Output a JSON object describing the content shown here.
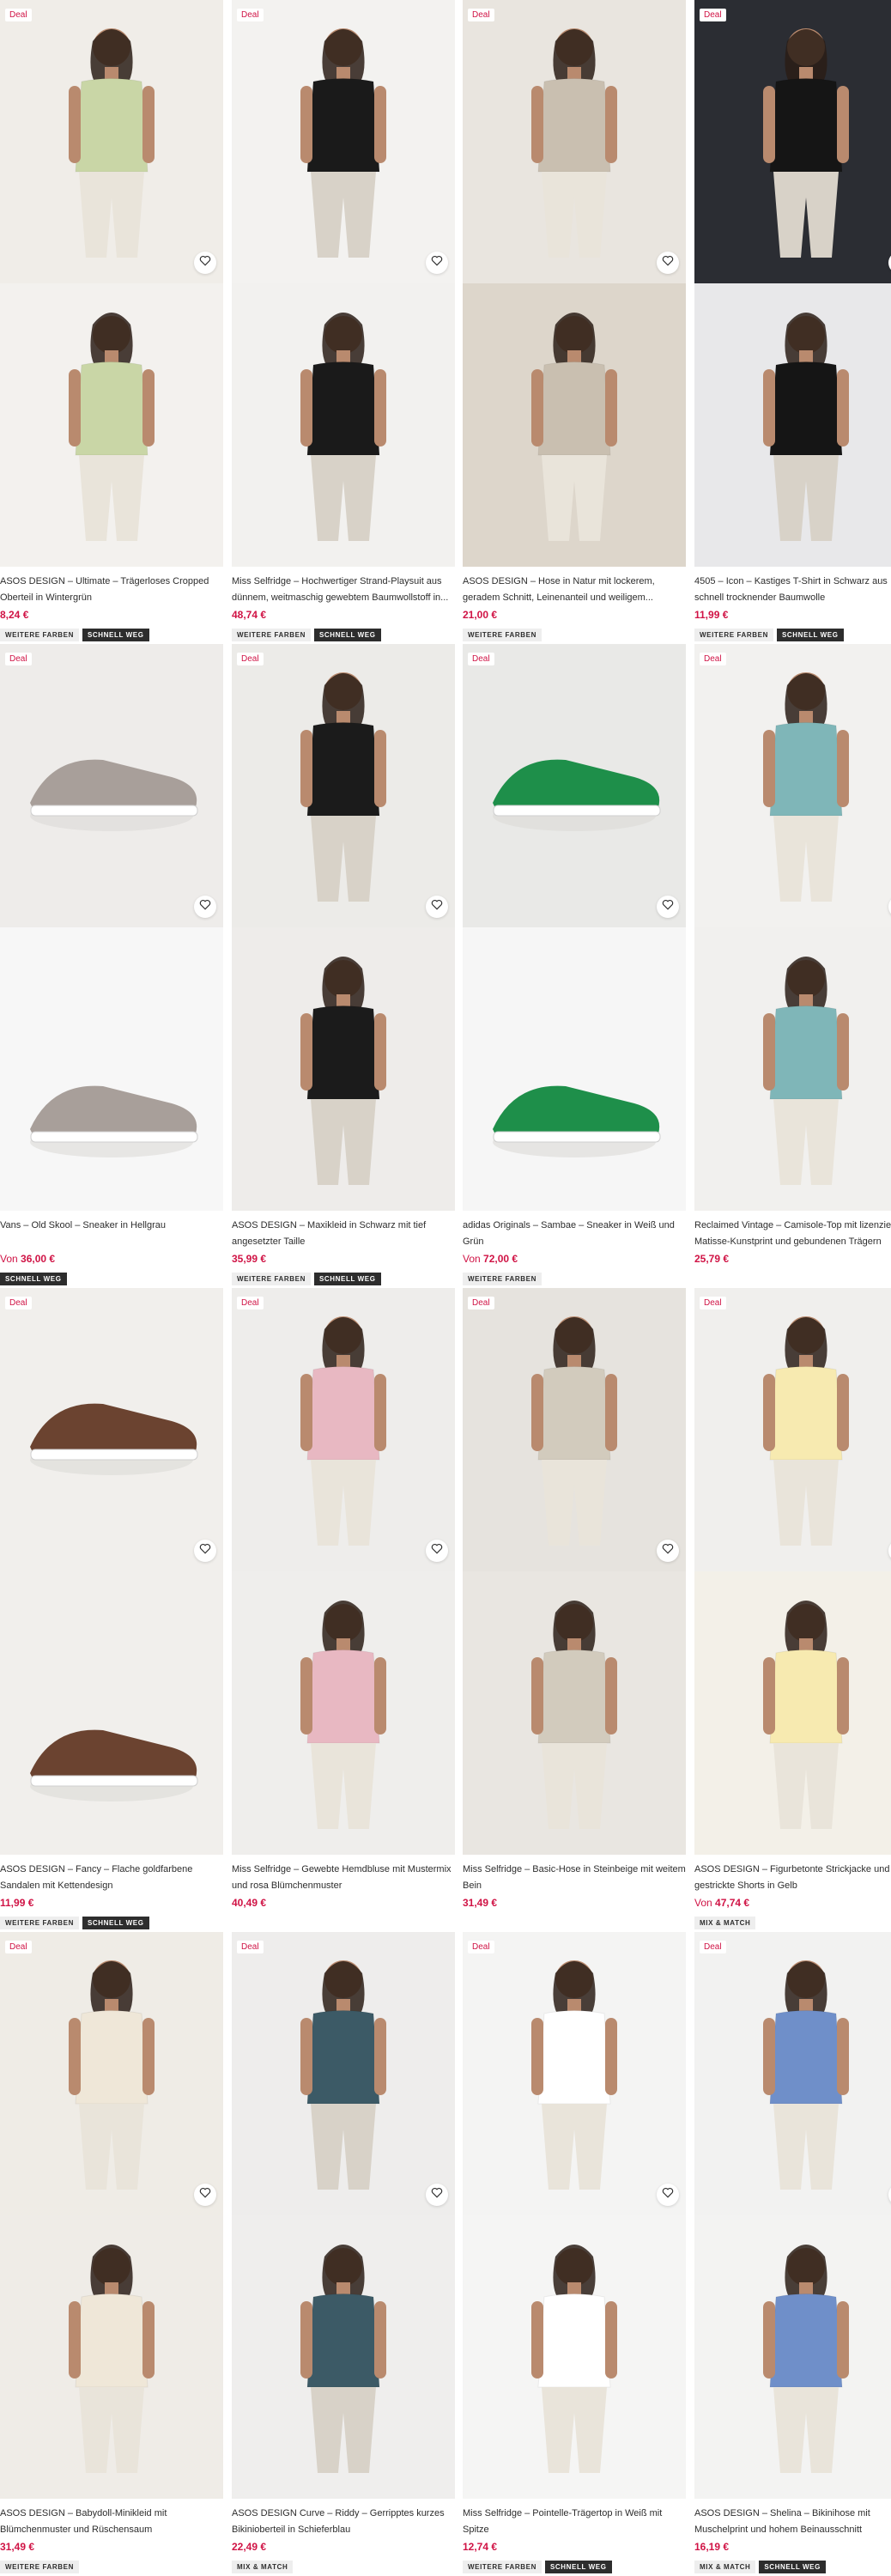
{
  "page": {
    "deal_label": "Deal"
  },
  "products": [
    {
      "title": "ASOS DESIGN – Ultimate – Trägerloses Cropped Oberteil in Wintergrün",
      "price": "8,24 €",
      "price_prefix": "",
      "deal": true,
      "badges": [
        "WEITERE FARBEN",
        "SCHNELL WEG"
      ],
      "bg_top": "#f0ede8",
      "bg_bot": "#f3f1ee",
      "accent": "#c9d6a6"
    },
    {
      "title": "Miss Selfridge – Hochwertiger Strand-Playsuit aus dünnem, weitmaschig gewebtem Baumwollstoff in...",
      "price": "48,74 €",
      "price_prefix": "",
      "deal": true,
      "badges": [
        "WEITERE FARBEN",
        "SCHNELL WEG"
      ],
      "bg_top": "#f3f2f0",
      "bg_bot": "#f2f1ef",
      "accent": "#1a1a1a"
    },
    {
      "title": "ASOS DESIGN – Hose in Natur mit lockerem, geradem Schnitt, Leinenanteil und weiligem...",
      "price": "21,00 €",
      "price_prefix": "",
      "deal": true,
      "badges": [
        "WEITERE FARBEN"
      ],
      "bg_top": "#e9e5df",
      "bg_bot": "#ddd6cb",
      "accent": "#c9bfb0"
    },
    {
      "title": "4505 – Icon – Kastiges T-Shirt in Schwarz aus schnell trocknender Baumwolle",
      "price": "11,99 €",
      "price_prefix": "",
      "deal": true,
      "badges": [
        "WEITERE FARBEN",
        "SCHNELL WEG"
      ],
      "bg_top": "#2b2d33",
      "bg_bot": "#e8e8ea",
      "accent": "#151515"
    },
    {
      "title": "Vans – Old Skool – Sneaker in Hellgrau",
      "price": "36,00 €",
      "price_prefix": "Von",
      "deal": true,
      "badges": [
        "SCHNELL WEG"
      ],
      "bg_top": "#eeecea",
      "bg_bot": "#f7f7f7",
      "accent": "#a89f9a"
    },
    {
      "title": "ASOS DESIGN – Maxikleid in Schwarz mit tief angesetzter Taille",
      "price": "35,99 €",
      "price_prefix": "",
      "deal": true,
      "badges": [
        "WEITERE FARBEN",
        "SCHNELL WEG"
      ],
      "bg_top": "#ecebe8",
      "bg_bot": "#eeecea",
      "accent": "#1b1b1b"
    },
    {
      "title": "adidas Originals – Sambae – Sneaker in Weiß und Grün",
      "price": "72,00 €",
      "price_prefix": "Von",
      "deal": true,
      "badges": [
        "WEITERE FARBEN"
      ],
      "bg_top": "#e9e9e7",
      "bg_bot": "#f6f6f6",
      "accent": "#1e8f4a"
    },
    {
      "title": "Reclaimed Vintage – Camisole-Top mit lizenzierten Matisse-Kunstprint und gebundenen Trägern",
      "price": "25,79 €",
      "price_prefix": "",
      "deal": true,
      "badges": [],
      "bg_top": "#f2f1ef",
      "bg_bot": "#f1f0ee",
      "accent": "#7fb6b8"
    },
    {
      "title": "ASOS DESIGN – Fancy – Flache goldfarbene Sandalen mit Kettendesign",
      "price": "11,99 €",
      "price_prefix": "",
      "deal": true,
      "badges": [
        "WEITERE FARBEN",
        "SCHNELL WEG"
      ],
      "bg_top": "#f1efec",
      "bg_bot": "#f1efec",
      "accent": "#6b4330"
    },
    {
      "title": "Miss Selfridge – Gewebte Hemdbluse mit Mustermix und rosa Blümchenmuster",
      "price": "40,49 €",
      "price_prefix": "",
      "deal": true,
      "badges": [],
      "bg_top": "#eeedeb",
      "bg_bot": "#efeeec",
      "accent": "#e8b8c2"
    },
    {
      "title": "Miss Selfridge – Basic-Hose in Steinbeige mit weitem Bein",
      "price": "31,49 €",
      "price_prefix": "",
      "deal": true,
      "badges": [],
      "bg_top": "#e6e3de",
      "bg_bot": "#e9e6e1",
      "accent": "#d2cbbd"
    },
    {
      "title": "ASOS DESIGN – Figurbetonte Strickjacke und gestrickte Shorts in Gelb",
      "price": "47,74 €",
      "price_prefix": "Von",
      "deal": true,
      "badges": [
        "MIX & MATCH"
      ],
      "bg_top": "#f0efed",
      "bg_bot": "#f3f0e8",
      "accent": "#f7eab0"
    },
    {
      "title": "ASOS DESIGN – Babydoll-Minikleid mit Blümchenmuster und Rüschensaum",
      "price": "31,49 €",
      "price_prefix": "",
      "deal": true,
      "badges": [
        "WEITERE FARBEN"
      ],
      "bg_top": "#efece6",
      "bg_bot": "#efece7",
      "accent": "#efe7d8"
    },
    {
      "title": "ASOS DESIGN Curve – Riddy – Gerripptes kurzes Bikinioberteil in Schieferblau",
      "price": "22,49 €",
      "price_prefix": "",
      "deal": true,
      "badges": [
        "MIX & MATCH"
      ],
      "bg_top": "#eeedec",
      "bg_bot": "#efeeed",
      "accent": "#3c5a66"
    },
    {
      "title": "Miss Selfridge – Pointelle-Trägertop in Weiß mit Spitze",
      "price": "12,74 €",
      "price_prefix": "",
      "deal": true,
      "badges": [
        "WEITERE FARBEN",
        "SCHNELL WEG"
      ],
      "bg_top": "#f4f4f3",
      "bg_bot": "#f5f5f4",
      "accent": "#ffffff"
    },
    {
      "title": "ASOS DESIGN – Shelina – Bikinihose mit Muschelprint und hohem Beinausschnitt",
      "price": "16,19 €",
      "price_prefix": "",
      "deal": true,
      "badges": [
        "MIX & MATCH",
        "SCHNELL WEG"
      ],
      "bg_top": "#f2f2f1",
      "bg_bot": "#f3f3f2",
      "accent": "#6f8fc9"
    }
  ]
}
